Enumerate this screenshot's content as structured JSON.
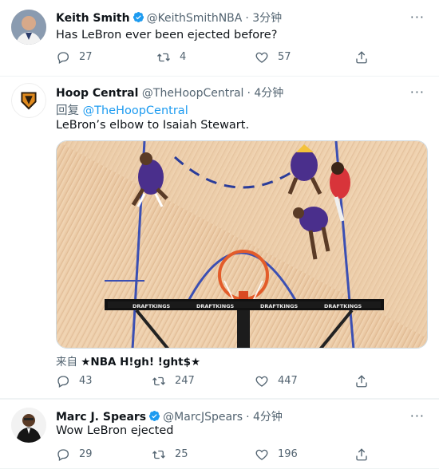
{
  "tweets": [
    {
      "name": "Keith Smith",
      "handle": "@KeithSmithNBA",
      "time": "· 3分钟",
      "text": "Has LeBron ever been ejected before?",
      "replies": "27",
      "retweets": "4",
      "likes": "57"
    },
    {
      "name": "Hoop Central",
      "handle": "@TheHoopCentral",
      "time": "· 4分钟",
      "reply_prefix": "回复",
      "reply_handle": "@TheHoopCentral",
      "text": "LeBron’s elbow to Isaiah Stewart.",
      "via_prefix": "来自",
      "via_source": "★NBA H!gh! !ght$★",
      "replies": "43",
      "retweets": "247",
      "likes": "447"
    },
    {
      "name": "Marc J. Spears",
      "handle": "@MarcJSpears",
      "time": "· 4分钟",
      "text": "Wow LeBron ejected",
      "replies": "29",
      "retweets": "25",
      "likes": "196"
    }
  ],
  "media": {
    "banner_text": "DRAFTKINGS"
  },
  "icons": {
    "more": "more-icon",
    "reply": "reply-icon",
    "retweet": "retweet-icon",
    "like": "heart-icon",
    "share": "share-icon",
    "verified": "verified-badge-icon"
  },
  "colors": {
    "verified": "#1d9bf0",
    "secondary_text": "#536471",
    "link": "#1d9bf0"
  }
}
